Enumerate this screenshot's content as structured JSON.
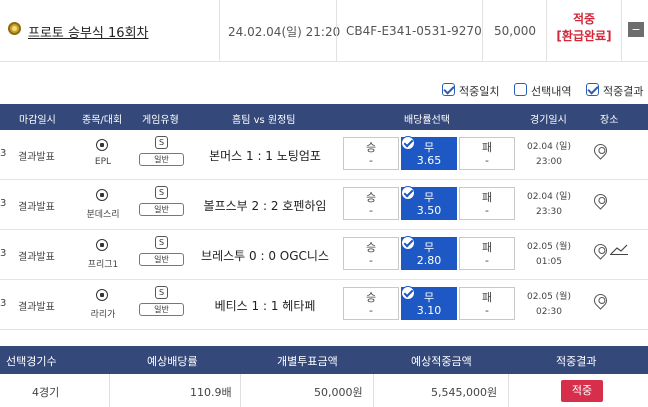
{
  "ticket": {
    "title": "프로토 승부식 16회차",
    "datetime": "24.02.04(일) 21:20",
    "code": "CB4F-E341-0531-9270",
    "amount": "50,000",
    "result_line1": "적중",
    "result_line2": "[환급완료]",
    "collapse_label": "−"
  },
  "filters": [
    {
      "label": "적중일치",
      "checked": true
    },
    {
      "label": "선택내역",
      "checked": false
    },
    {
      "label": "적중결과",
      "checked": true
    }
  ],
  "table": {
    "headers": [
      "마감일시",
      "종목/대회",
      "게임유형",
      "홈팀 vs 원정팀",
      "배당률선택",
      "경기일시",
      "장소"
    ],
    "rows": [
      {
        "num": "3",
        "status": "결과발표",
        "league": "EPL",
        "badge": "S",
        "game_type": "일반",
        "match": "본머스 1 : 1 노팅엄포",
        "win": {
          "label": "승",
          "odds": "-"
        },
        "draw": {
          "label": "무",
          "odds": "3.65"
        },
        "lose": {
          "label": "패",
          "odds": "-"
        },
        "date": "02.04 (일)",
        "time": "23:00"
      },
      {
        "num": "3",
        "status": "결과발표",
        "league": "분데스리",
        "badge": "S",
        "game_type": "일반",
        "match": "볼프스부 2 : 2 호펜하임",
        "win": {
          "label": "승",
          "odds": "-"
        },
        "draw": {
          "label": "무",
          "odds": "3.50"
        },
        "lose": {
          "label": "패",
          "odds": "-"
        },
        "date": "02.04 (일)",
        "time": "23:30"
      },
      {
        "num": "3",
        "status": "결과발표",
        "league": "프리그1",
        "badge": "S",
        "game_type": "일반",
        "match": "브레스투 0 : 0 OGC니스",
        "win": {
          "label": "승",
          "odds": "-"
        },
        "draw": {
          "label": "무",
          "odds": "2.80"
        },
        "lose": {
          "label": "패",
          "odds": "-"
        },
        "date": "02.05 (월)",
        "time": "01:05"
      },
      {
        "num": "3",
        "status": "결과발표",
        "league": "라리가",
        "badge": "S",
        "game_type": "일반",
        "match": "베티스 1 : 1 헤타페",
        "win": {
          "label": "승",
          "odds": "-"
        },
        "draw": {
          "label": "무",
          "odds": "3.10"
        },
        "lose": {
          "label": "패",
          "odds": "-"
        },
        "date": "02.05 (월)",
        "time": "02:30"
      }
    ]
  },
  "summary": {
    "headers": [
      "선택경기수",
      "예상배당률",
      "개별투표금액",
      "예상적중금액",
      "적중결과"
    ],
    "values": [
      "4경기",
      "110.9배",
      "50,000원",
      "5,545,000원",
      "적중"
    ]
  },
  "colors": {
    "header_bg": "#34487a",
    "selected_odds": "#1d58c4",
    "hit_red": "#d62e4b"
  }
}
